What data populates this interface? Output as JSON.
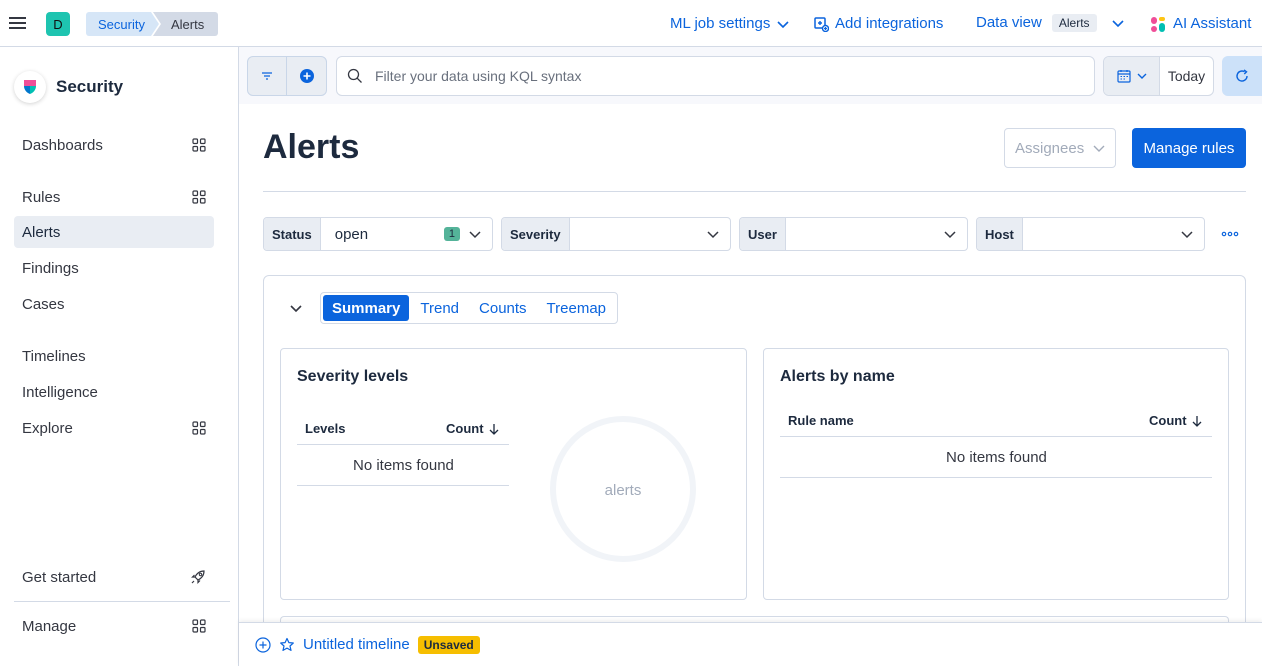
{
  "header": {
    "space_initial": "D",
    "breadcrumbs": [
      "Security",
      "Alerts"
    ],
    "ml_job_settings": "ML job settings",
    "add_integrations": "Add integrations",
    "data_view_label": "Data view",
    "data_view_value": "Alerts",
    "ai_assistant": "AI Assistant"
  },
  "nav": {
    "title": "Security",
    "items": [
      {
        "label": "Dashboards",
        "has_grid": true
      },
      {
        "label": "Rules",
        "has_grid": true
      },
      {
        "label": "Alerts",
        "active": true
      },
      {
        "label": "Findings"
      },
      {
        "label": "Cases"
      },
      {
        "label": "Timelines"
      },
      {
        "label": "Intelligence"
      },
      {
        "label": "Explore",
        "has_grid": true
      }
    ],
    "get_started": "Get started",
    "manage": "Manage"
  },
  "search": {
    "placeholder": "Filter your data using KQL syntax",
    "date_label": "Today"
  },
  "main": {
    "title": "Alerts",
    "assignees": "Assignees",
    "manage_rules": "Manage rules",
    "filters": [
      {
        "label": "Status",
        "value": "open",
        "count": "1"
      },
      {
        "label": "Severity",
        "value": ""
      },
      {
        "label": "User",
        "value": ""
      },
      {
        "label": "Host",
        "value": ""
      }
    ],
    "tabs": [
      "Summary",
      "Trend",
      "Counts",
      "Treemap"
    ],
    "severity_card": {
      "title": "Severity levels",
      "col_levels": "Levels",
      "col_count": "Count",
      "empty": "No items found",
      "donut_label": "alerts"
    },
    "name_card": {
      "title": "Alerts by name",
      "col_rule": "Rule name",
      "col_count": "Count",
      "empty": "No items found"
    }
  },
  "timeline": {
    "title": "Untitled timeline",
    "badge": "Unsaved"
  },
  "colors": {
    "accent": "#0b64dd",
    "space_badge": "#1ec4b0",
    "unsaved": "#f6be00"
  }
}
